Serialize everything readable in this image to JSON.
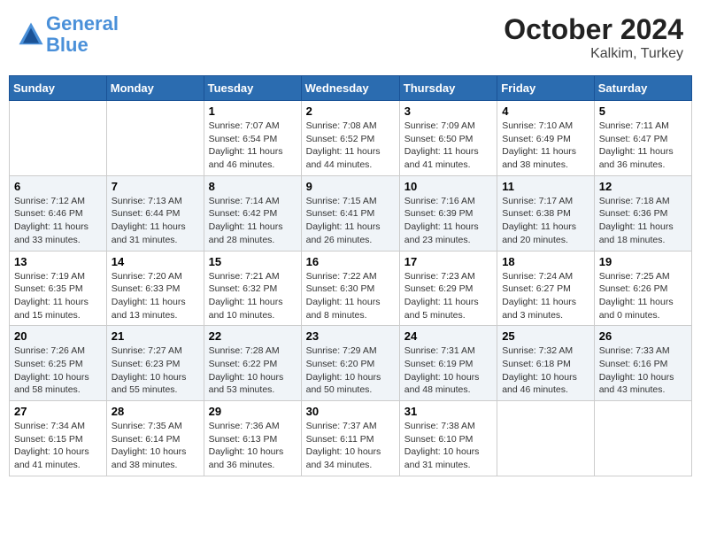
{
  "header": {
    "logo_line1": "General",
    "logo_line2": "Blue",
    "month": "October 2024",
    "location": "Kalkim, Turkey"
  },
  "weekdays": [
    "Sunday",
    "Monday",
    "Tuesday",
    "Wednesday",
    "Thursday",
    "Friday",
    "Saturday"
  ],
  "weeks": [
    [
      {
        "day": "",
        "sunrise": "",
        "sunset": "",
        "daylight": ""
      },
      {
        "day": "",
        "sunrise": "",
        "sunset": "",
        "daylight": ""
      },
      {
        "day": "1",
        "sunrise": "Sunrise: 7:07 AM",
        "sunset": "Sunset: 6:54 PM",
        "daylight": "Daylight: 11 hours and 46 minutes."
      },
      {
        "day": "2",
        "sunrise": "Sunrise: 7:08 AM",
        "sunset": "Sunset: 6:52 PM",
        "daylight": "Daylight: 11 hours and 44 minutes."
      },
      {
        "day": "3",
        "sunrise": "Sunrise: 7:09 AM",
        "sunset": "Sunset: 6:50 PM",
        "daylight": "Daylight: 11 hours and 41 minutes."
      },
      {
        "day": "4",
        "sunrise": "Sunrise: 7:10 AM",
        "sunset": "Sunset: 6:49 PM",
        "daylight": "Daylight: 11 hours and 38 minutes."
      },
      {
        "day": "5",
        "sunrise": "Sunrise: 7:11 AM",
        "sunset": "Sunset: 6:47 PM",
        "daylight": "Daylight: 11 hours and 36 minutes."
      }
    ],
    [
      {
        "day": "6",
        "sunrise": "Sunrise: 7:12 AM",
        "sunset": "Sunset: 6:46 PM",
        "daylight": "Daylight: 11 hours and 33 minutes."
      },
      {
        "day": "7",
        "sunrise": "Sunrise: 7:13 AM",
        "sunset": "Sunset: 6:44 PM",
        "daylight": "Daylight: 11 hours and 31 minutes."
      },
      {
        "day": "8",
        "sunrise": "Sunrise: 7:14 AM",
        "sunset": "Sunset: 6:42 PM",
        "daylight": "Daylight: 11 hours and 28 minutes."
      },
      {
        "day": "9",
        "sunrise": "Sunrise: 7:15 AM",
        "sunset": "Sunset: 6:41 PM",
        "daylight": "Daylight: 11 hours and 26 minutes."
      },
      {
        "day": "10",
        "sunrise": "Sunrise: 7:16 AM",
        "sunset": "Sunset: 6:39 PM",
        "daylight": "Daylight: 11 hours and 23 minutes."
      },
      {
        "day": "11",
        "sunrise": "Sunrise: 7:17 AM",
        "sunset": "Sunset: 6:38 PM",
        "daylight": "Daylight: 11 hours and 20 minutes."
      },
      {
        "day": "12",
        "sunrise": "Sunrise: 7:18 AM",
        "sunset": "Sunset: 6:36 PM",
        "daylight": "Daylight: 11 hours and 18 minutes."
      }
    ],
    [
      {
        "day": "13",
        "sunrise": "Sunrise: 7:19 AM",
        "sunset": "Sunset: 6:35 PM",
        "daylight": "Daylight: 11 hours and 15 minutes."
      },
      {
        "day": "14",
        "sunrise": "Sunrise: 7:20 AM",
        "sunset": "Sunset: 6:33 PM",
        "daylight": "Daylight: 11 hours and 13 minutes."
      },
      {
        "day": "15",
        "sunrise": "Sunrise: 7:21 AM",
        "sunset": "Sunset: 6:32 PM",
        "daylight": "Daylight: 11 hours and 10 minutes."
      },
      {
        "day": "16",
        "sunrise": "Sunrise: 7:22 AM",
        "sunset": "Sunset: 6:30 PM",
        "daylight": "Daylight: 11 hours and 8 minutes."
      },
      {
        "day": "17",
        "sunrise": "Sunrise: 7:23 AM",
        "sunset": "Sunset: 6:29 PM",
        "daylight": "Daylight: 11 hours and 5 minutes."
      },
      {
        "day": "18",
        "sunrise": "Sunrise: 7:24 AM",
        "sunset": "Sunset: 6:27 PM",
        "daylight": "Daylight: 11 hours and 3 minutes."
      },
      {
        "day": "19",
        "sunrise": "Sunrise: 7:25 AM",
        "sunset": "Sunset: 6:26 PM",
        "daylight": "Daylight: 11 hours and 0 minutes."
      }
    ],
    [
      {
        "day": "20",
        "sunrise": "Sunrise: 7:26 AM",
        "sunset": "Sunset: 6:25 PM",
        "daylight": "Daylight: 10 hours and 58 minutes."
      },
      {
        "day": "21",
        "sunrise": "Sunrise: 7:27 AM",
        "sunset": "Sunset: 6:23 PM",
        "daylight": "Daylight: 10 hours and 55 minutes."
      },
      {
        "day": "22",
        "sunrise": "Sunrise: 7:28 AM",
        "sunset": "Sunset: 6:22 PM",
        "daylight": "Daylight: 10 hours and 53 minutes."
      },
      {
        "day": "23",
        "sunrise": "Sunrise: 7:29 AM",
        "sunset": "Sunset: 6:20 PM",
        "daylight": "Daylight: 10 hours and 50 minutes."
      },
      {
        "day": "24",
        "sunrise": "Sunrise: 7:31 AM",
        "sunset": "Sunset: 6:19 PM",
        "daylight": "Daylight: 10 hours and 48 minutes."
      },
      {
        "day": "25",
        "sunrise": "Sunrise: 7:32 AM",
        "sunset": "Sunset: 6:18 PM",
        "daylight": "Daylight: 10 hours and 46 minutes."
      },
      {
        "day": "26",
        "sunrise": "Sunrise: 7:33 AM",
        "sunset": "Sunset: 6:16 PM",
        "daylight": "Daylight: 10 hours and 43 minutes."
      }
    ],
    [
      {
        "day": "27",
        "sunrise": "Sunrise: 7:34 AM",
        "sunset": "Sunset: 6:15 PM",
        "daylight": "Daylight: 10 hours and 41 minutes."
      },
      {
        "day": "28",
        "sunrise": "Sunrise: 7:35 AM",
        "sunset": "Sunset: 6:14 PM",
        "daylight": "Daylight: 10 hours and 38 minutes."
      },
      {
        "day": "29",
        "sunrise": "Sunrise: 7:36 AM",
        "sunset": "Sunset: 6:13 PM",
        "daylight": "Daylight: 10 hours and 36 minutes."
      },
      {
        "day": "30",
        "sunrise": "Sunrise: 7:37 AM",
        "sunset": "Sunset: 6:11 PM",
        "daylight": "Daylight: 10 hours and 34 minutes."
      },
      {
        "day": "31",
        "sunrise": "Sunrise: 7:38 AM",
        "sunset": "Sunset: 6:10 PM",
        "daylight": "Daylight: 10 hours and 31 minutes."
      },
      {
        "day": "",
        "sunrise": "",
        "sunset": "",
        "daylight": ""
      },
      {
        "day": "",
        "sunrise": "",
        "sunset": "",
        "daylight": ""
      }
    ]
  ]
}
